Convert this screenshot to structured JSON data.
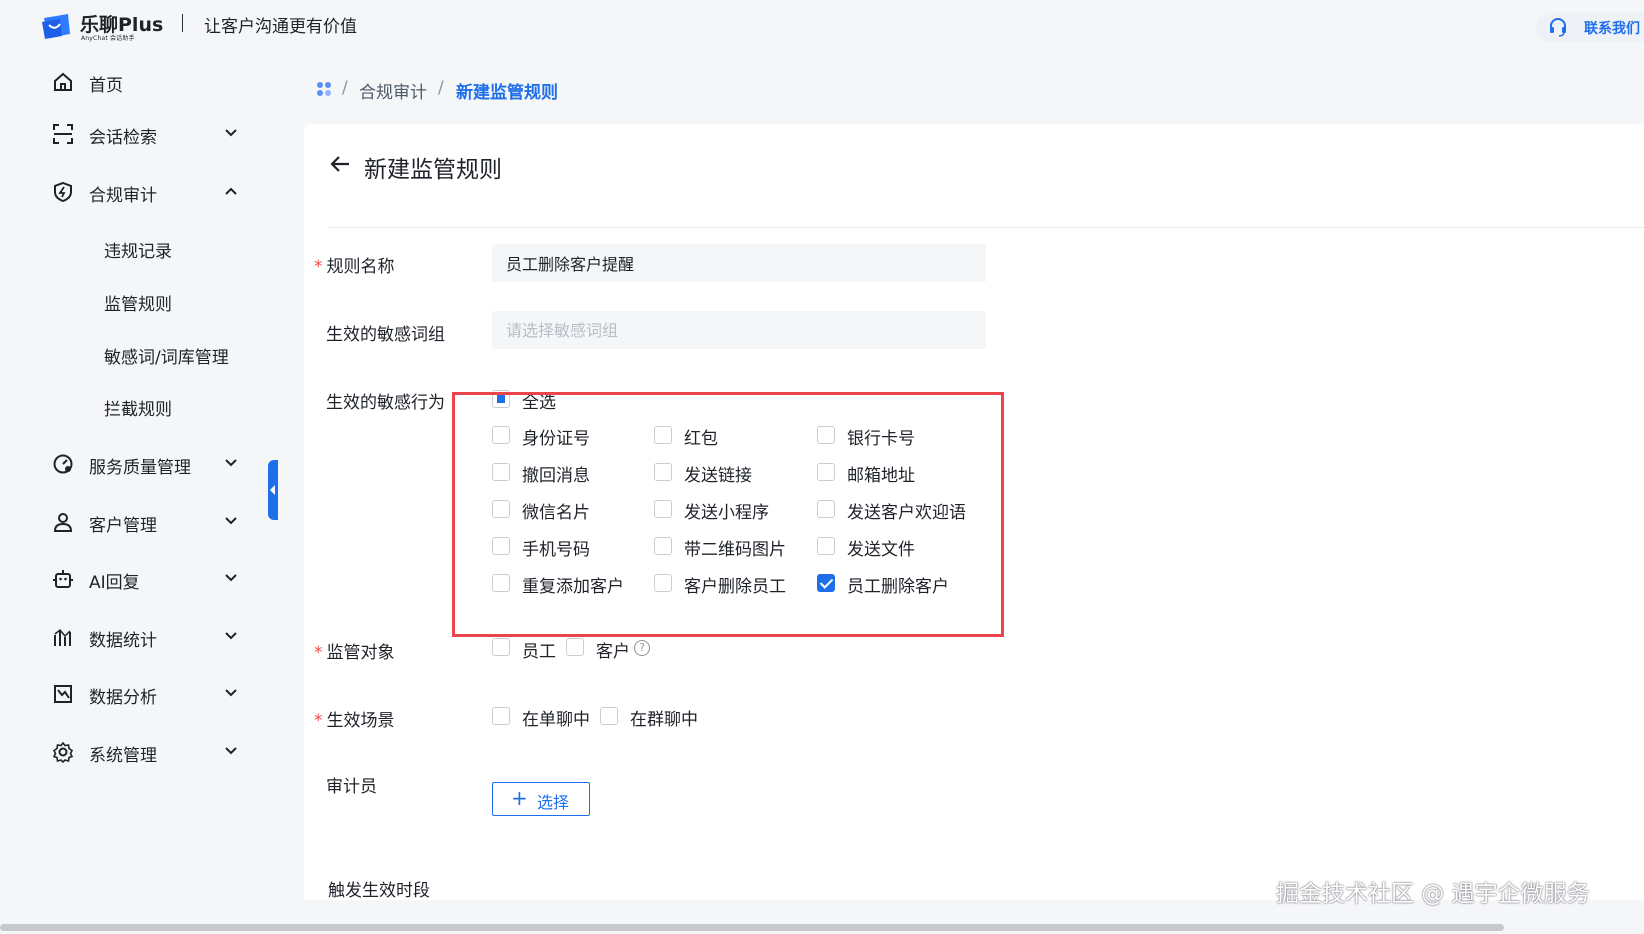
{
  "header": {
    "brand": "乐聊Plus",
    "brand_sub": "AnyChat 会话助手",
    "slogan": "让客户沟通更有价值",
    "contact": "联系我们"
  },
  "sidebar": {
    "items": [
      {
        "label": "首页",
        "icon": "home-icon"
      },
      {
        "label": "会话检索",
        "icon": "scan-icon"
      },
      {
        "label": "合规审计",
        "icon": "shield-icon",
        "expanded": true,
        "children": [
          "违规记录",
          "监管规则",
          "敏感词/词库管理",
          "拦截规则"
        ]
      },
      {
        "label": "服务质量管理",
        "icon": "gauge-icon"
      },
      {
        "label": "客户管理",
        "icon": "user-icon"
      },
      {
        "label": "AI回复",
        "icon": "robot-icon"
      },
      {
        "label": "数据统计",
        "icon": "chart-icon"
      },
      {
        "label": "数据分析",
        "icon": "analysis-icon"
      },
      {
        "label": "系统管理",
        "icon": "gear-icon"
      }
    ]
  },
  "breadcrumb": {
    "parent": "合规审计",
    "current": "新建监管规则",
    "separator": "/"
  },
  "page": {
    "title": "新建监管规则"
  },
  "form": {
    "rule_name": {
      "label": "规则名称",
      "value": "员工删除客户提醒",
      "required": true
    },
    "word_group": {
      "label": "生效的敏感词组",
      "placeholder": "请选择敏感词组"
    },
    "behaviors": {
      "label": "生效的敏感行为",
      "select_all": "全选",
      "select_all_state": "indeterminate",
      "options": [
        {
          "label": "身份证号",
          "checked": false
        },
        {
          "label": "红包",
          "checked": false
        },
        {
          "label": "银行卡号",
          "checked": false
        },
        {
          "label": "撤回消息",
          "checked": false
        },
        {
          "label": "发送链接",
          "checked": false
        },
        {
          "label": "邮箱地址",
          "checked": false
        },
        {
          "label": "微信名片",
          "checked": false
        },
        {
          "label": "发送小程序",
          "checked": false
        },
        {
          "label": "发送客户欢迎语",
          "checked": false
        },
        {
          "label": "手机号码",
          "checked": false
        },
        {
          "label": "带二维码图片",
          "checked": false
        },
        {
          "label": "发送文件",
          "checked": false
        },
        {
          "label": "重复添加客户",
          "checked": false
        },
        {
          "label": "客户删除员工",
          "checked": false
        },
        {
          "label": "员工删除客户",
          "checked": true
        }
      ]
    },
    "target": {
      "label": "监管对象",
      "required": true,
      "options": [
        "员工",
        "客户"
      ]
    },
    "scene": {
      "label": "生效场景",
      "required": true,
      "options": [
        "在单聊中",
        "在群聊中"
      ]
    },
    "auditor": {
      "label": "审计员",
      "button": "选择"
    },
    "partial_label": "触发生效时段"
  },
  "watermark": "掘金技术社区 @ 遇宇企微服务",
  "colors": {
    "accent": "#1f6feb",
    "highlight": "#e9454a",
    "required": "#f54a45"
  }
}
